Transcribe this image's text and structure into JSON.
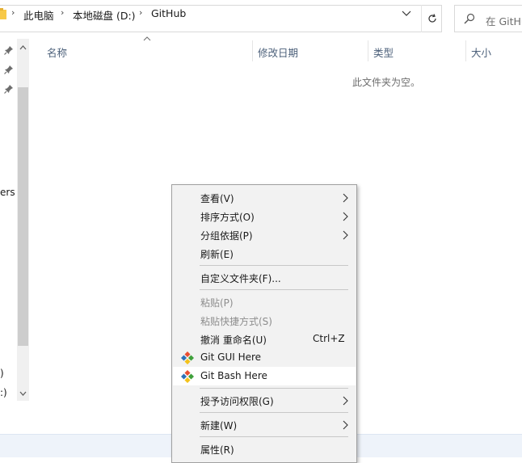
{
  "address": {
    "crumbs": [
      "此电脑",
      "本地磁盘 (D:)",
      "GitHub"
    ],
    "separator": "›"
  },
  "search": {
    "placeholder": "在 GitHub"
  },
  "nav": {
    "fragments": [
      "ers",
      ")",
      ":)"
    ]
  },
  "columns": [
    "名称",
    "修改日期",
    "类型",
    "大小"
  ],
  "empty_message": "此文件夹为空。",
  "menu": {
    "items": [
      {
        "label": "查看(V)",
        "submenu": true
      },
      {
        "label": "排序方式(O)",
        "submenu": true
      },
      {
        "label": "分组依据(P)",
        "submenu": true
      },
      {
        "label": "刷新(E)"
      },
      {
        "label": "自定义文件夹(F)..."
      },
      {
        "label": "粘贴(P)",
        "disabled": true
      },
      {
        "label": "粘贴快捷方式(S)",
        "disabled": true
      },
      {
        "label": "撤消 重命名(U)",
        "shortcut": "Ctrl+Z"
      },
      {
        "label": "Git GUI Here",
        "icon": "git-icon"
      },
      {
        "label": "Git Bash Here",
        "icon": "git-icon",
        "highlighted": true
      },
      {
        "label": "授予访问权限(G)",
        "submenu": true
      },
      {
        "label": "新建(W)",
        "submenu": true
      },
      {
        "label": "属性(R)"
      }
    ]
  },
  "colors": {
    "accent": "#0078d7",
    "git_red": "#e94e31",
    "git_green": "#3fa03b",
    "git_blue": "#2d72b8",
    "git_yellow": "#f3c21b"
  }
}
